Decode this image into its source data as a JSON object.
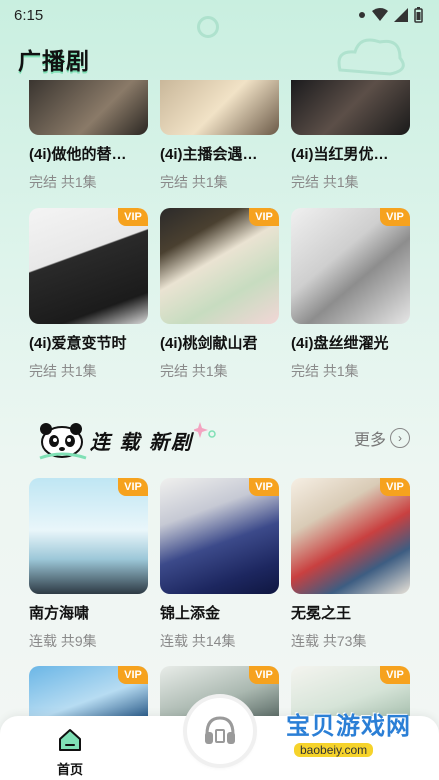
{
  "status": {
    "time": "6:15"
  },
  "page": {
    "title": "广播剧"
  },
  "top_row": [
    {
      "title": "(4i)做他的替…",
      "meta": "完结 共1集",
      "vip": ""
    },
    {
      "title": "(4i)主播会遇…",
      "meta": "完结 共1集",
      "vip": ""
    },
    {
      "title": "(4i)当红男优…",
      "meta": "完结 共1集",
      "vip": ""
    }
  ],
  "second_row": [
    {
      "title": "(4i)爱意变节时",
      "meta": "完结 共1集",
      "vip": "VIP"
    },
    {
      "title": "(4i)桃剑献山君",
      "meta": "完结 共1集",
      "vip": "VIP"
    },
    {
      "title": "(4i)盘丝绁濯光",
      "meta": "完结 共1集",
      "vip": "VIP"
    }
  ],
  "serial_section": {
    "title": "连 载 新剧",
    "more": "更多",
    "items": [
      {
        "title": "南方海啸",
        "meta": "连载 共9集",
        "vip": "VIP"
      },
      {
        "title": "锦上添金",
        "meta": "连载 共14集",
        "vip": "VIP"
      },
      {
        "title": "无冕之王",
        "meta": "连载 共73集",
        "vip": "VIP"
      }
    ],
    "next_row": [
      {
        "vip": "VIP"
      },
      {
        "vip": "VIP"
      },
      {
        "vip": "VIP"
      }
    ]
  },
  "bottom_nav": {
    "home": "首页"
  },
  "watermark": {
    "title": "宝贝游戏网",
    "url": "baobeiy.com"
  },
  "colors": {
    "accent": "#7fe0b5",
    "vip": "#f6a21e"
  }
}
